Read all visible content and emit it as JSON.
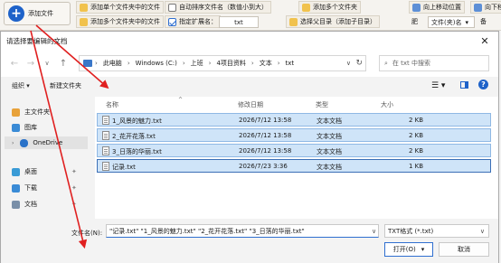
{
  "app": {
    "add_file_label": "添加文件",
    "toolbar_row1": [
      {
        "label": "添加单个文件夹中的文件",
        "icon": "folder-icon"
      },
      {
        "label": "自动排序文件名（数值小到大）",
        "icon": "checkbox-icon"
      },
      {
        "label": "添加多个文件夹",
        "icon": "folder-icon"
      },
      {
        "label": "向上移动位置",
        "icon": "arrow-up-icon"
      },
      {
        "label": "向下移",
        "icon": "arrow-down-icon"
      }
    ],
    "toolbar_row2": [
      {
        "label": "添加多个文件夹中的文件",
        "icon": "folder-icon"
      },
      {
        "label": "指定扩展名：",
        "icon": "checkbox-checked-icon"
      },
      {
        "label": "选择父目录（添加子目录）",
        "icon": "folder-icon"
      },
      {
        "label": "肥",
        "icon": ""
      }
    ],
    "extension_value": "txt",
    "sort_select_value": "文件(夹)名",
    "sort_select_suffix": "备"
  },
  "dialog": {
    "title": "请选择要编辑的文档",
    "close_glyph": "✕",
    "breadcrumbs": [
      "此电脑",
      "Windows (C:)",
      "上班",
      "4项目资料",
      "文本",
      "txt"
    ],
    "search_placeholder": "在 txt 中搜索",
    "organize_label": "组织 ▾",
    "new_folder_label": "新建文件夹",
    "sidebar": [
      {
        "label": "主文件夹",
        "icon": "home-icon",
        "color": "#e8a23a"
      },
      {
        "label": "图库",
        "icon": "gallery-icon",
        "color": "#3a8bd6"
      },
      {
        "label": "OneDrive",
        "icon": "cloud-icon",
        "color": "#2a72c8"
      },
      {
        "label": "桌面",
        "icon": "desktop-icon",
        "color": "#3a9bd6"
      },
      {
        "label": "下载",
        "icon": "download-icon",
        "color": "#3a8bd6"
      },
      {
        "label": "文档",
        "icon": "document-icon",
        "color": "#7a8fa8"
      }
    ],
    "columns": {
      "name": "名称",
      "modified": "修改日期",
      "type": "类型",
      "size": "大小"
    },
    "files": [
      {
        "name": "1_风景的魅力.txt",
        "modified": "2026/7/12 13:58",
        "type": "文本文档",
        "size": "2 KB"
      },
      {
        "name": "2_花开花落.txt",
        "modified": "2026/7/12 13:58",
        "type": "文本文档",
        "size": "2 KB"
      },
      {
        "name": "3_日落的华丽.txt",
        "modified": "2026/7/12 13:58",
        "type": "文本文档",
        "size": "2 KB"
      },
      {
        "name": "记录.txt",
        "modified": "2026/7/23 3:36",
        "type": "文本文档",
        "size": "1 KB"
      }
    ],
    "filename_label": "文件名(N):",
    "filename_value": "\"记录.txt\" \"1_风景的魅力.txt\" \"2_花开花落.txt\" \"3_日落的华丽.txt\"",
    "filetype_value": "TXT格式 (*.txt)",
    "open_label": "打开(O)",
    "open_dropdown": "▾",
    "cancel_label": "取消"
  },
  "colors": {
    "accent": "#1e62c9",
    "selection": "#cfe4f8",
    "annotation": "#e02020"
  }
}
